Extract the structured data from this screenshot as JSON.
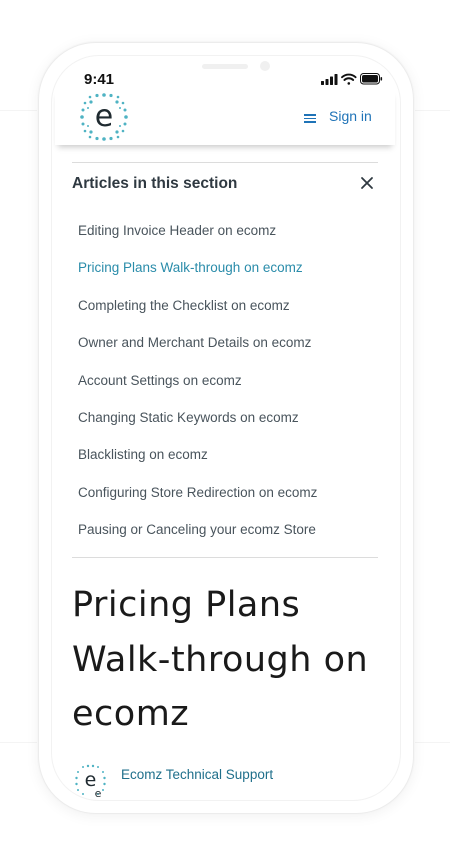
{
  "status_bar": {
    "time": "9:41"
  },
  "header": {
    "logo_letter": "e",
    "menu_icon": "hamburger-icon",
    "sign_in_label": "Sign in"
  },
  "articles_section": {
    "title": "Articles in this section",
    "close_icon": "close-icon",
    "items": [
      {
        "label": "Editing Invoice Header on ecomz",
        "active": false
      },
      {
        "label": "Pricing Plans Walk-through on ecomz",
        "active": true
      },
      {
        "label": "Completing the Checklist on ecomz",
        "active": false
      },
      {
        "label": "Owner and Merchant Details on ecomz",
        "active": false
      },
      {
        "label": "Account Settings on ecomz",
        "active": false
      },
      {
        "label": "Changing Static Keywords on ecomz",
        "active": false
      },
      {
        "label": "Blacklisting on ecomz",
        "active": false
      },
      {
        "label": "Configuring Store Redirection on ecomz",
        "active": false
      },
      {
        "label": "Pausing or Canceling your ecomz Store",
        "active": false
      }
    ]
  },
  "article": {
    "title": "Pricing Plans Walk-through on ecomz",
    "author": "Ecomz Technical Support"
  },
  "colors": {
    "link": "#1f73b7",
    "active_article": "#2a8caa",
    "logo_teal": "#4fb3c3",
    "text": "#49545c"
  }
}
